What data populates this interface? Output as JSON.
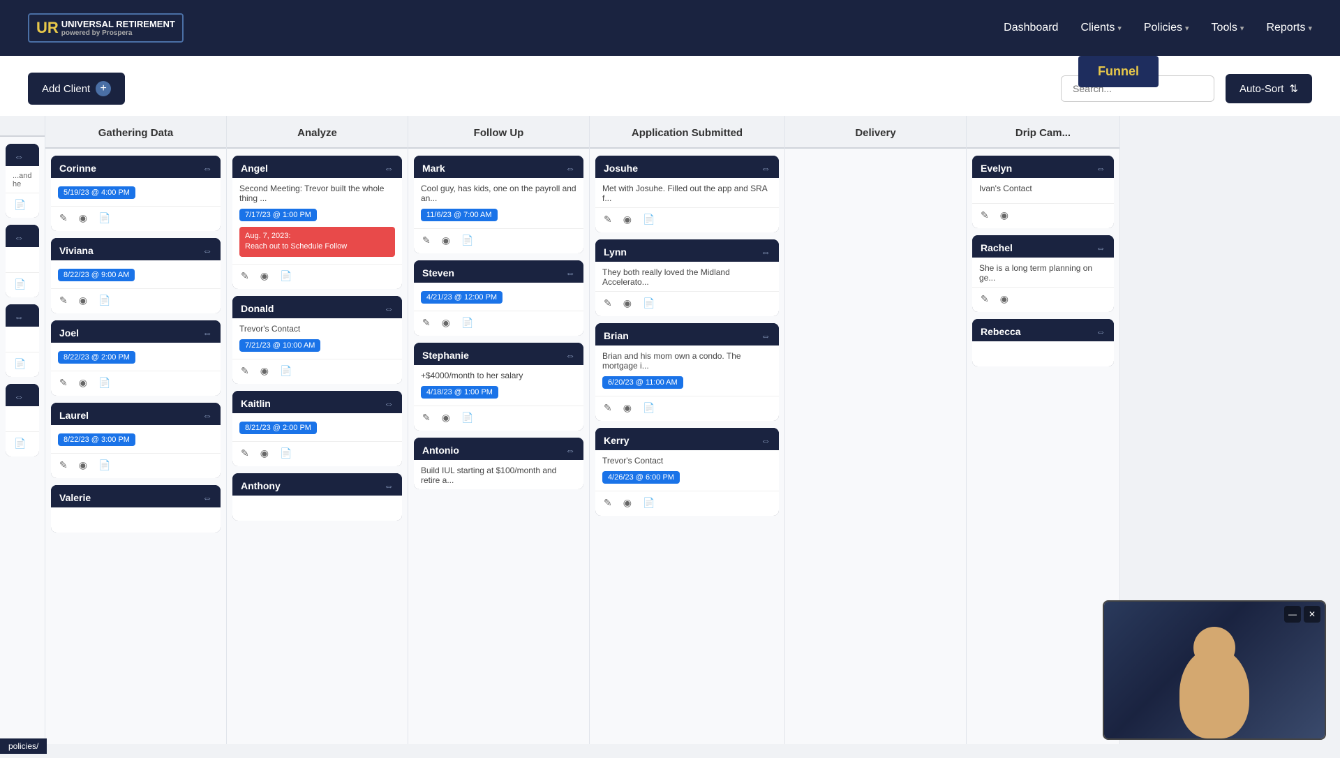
{
  "nav": {
    "logo_text": "UNIVERSAL RETIREMENT",
    "powered_text": "powered by Prospera",
    "links": [
      {
        "label": "Dashboard",
        "has_dropdown": false
      },
      {
        "label": "Clients",
        "has_dropdown": true
      },
      {
        "label": "Policies",
        "has_dropdown": true
      },
      {
        "label": "Tools",
        "has_dropdown": true
      },
      {
        "label": "Reports",
        "has_dropdown": true
      }
    ],
    "funnel_label": "Funnel"
  },
  "toolbar": {
    "add_client_label": "Add Client",
    "search_placeholder": "Search...",
    "autosort_label": "Auto-Sort"
  },
  "columns": [
    {
      "id": "partial-left",
      "header": "",
      "cards": [
        {
          "name": "",
          "move": true,
          "body": "...and he",
          "date": null,
          "date_text": null
        },
        {
          "name": "",
          "move": true,
          "body": "",
          "date": null,
          "date_text": null
        },
        {
          "name": "",
          "move": true,
          "body": "",
          "date": null,
          "date_text": null
        },
        {
          "name": "",
          "move": true,
          "body": "",
          "date": null,
          "date_text": null
        }
      ]
    },
    {
      "id": "gathering-data",
      "header": "Gathering Data",
      "cards": [
        {
          "name": "Corinne",
          "move": true,
          "body": "",
          "date": "5/19/23 @ 4:00 PM",
          "date_color": "blue"
        },
        {
          "name": "Viviana",
          "move": true,
          "body": "",
          "date": "8/22/23 @ 9:00 AM",
          "date_color": "blue"
        },
        {
          "name": "Joel",
          "move": true,
          "body": "",
          "date": "8/22/23 @ 2:00 PM",
          "date_color": "blue"
        },
        {
          "name": "Laurel",
          "move": true,
          "body": "",
          "date": "8/22/23 @ 3:00 PM",
          "date_color": "blue"
        },
        {
          "name": "Valerie",
          "move": true,
          "body": "",
          "date": null,
          "date_color": null
        }
      ]
    },
    {
      "id": "analyze",
      "header": "Analyze",
      "cards": [
        {
          "name": "Angel",
          "move": true,
          "body": "Second Meeting: Trevor built the whole thing ...",
          "date": "7/17/23 @ 1:00 PM",
          "date_color": "blue",
          "alert": "Aug. 7, 2023:\nReach out to Schedule Follow"
        },
        {
          "name": "Donald",
          "move": true,
          "body": "Trevor's Contact",
          "date": "7/21/23 @ 10:00 AM",
          "date_color": "blue"
        },
        {
          "name": "Kaitlin",
          "move": true,
          "body": "",
          "date": "8/21/23 @ 2:00 PM",
          "date_color": "blue"
        },
        {
          "name": "Anthony",
          "move": true,
          "body": "",
          "date": null,
          "date_color": null
        }
      ]
    },
    {
      "id": "follow-up",
      "header": "Follow Up",
      "cards": [
        {
          "name": "Mark",
          "move": true,
          "body": "Cool guy, has kids, one on the payroll and an...",
          "date": "11/6/23 @ 7:00 AM",
          "date_color": "blue"
        },
        {
          "name": "Steven",
          "move": true,
          "body": "",
          "date": "4/21/23 @ 12:00 PM",
          "date_color": "blue"
        },
        {
          "name": "Stephanie",
          "move": true,
          "body": "+$4000/month to her salary",
          "date": "4/18/23 @ 1:00 PM",
          "date_color": "blue"
        },
        {
          "name": "Antonio",
          "move": true,
          "body": "Build IUL starting at $100/month and retire a...",
          "date": null,
          "date_color": null
        }
      ]
    },
    {
      "id": "application-submitted",
      "header": "Application Submitted",
      "cards": [
        {
          "name": "Josuhe",
          "move": true,
          "body": "Met with Josuhe. Filled out the app and SRA f...",
          "date": null,
          "date_color": null
        },
        {
          "name": "Lynn",
          "move": true,
          "body": "They both really loved the Midland Accelerato...",
          "date": null,
          "date_color": null
        },
        {
          "name": "Brian",
          "move": true,
          "body": "Brian and his mom own a condo. The mortgage i...",
          "date": "6/20/23 @ 11:00 AM",
          "date_color": "blue"
        },
        {
          "name": "Kerry",
          "move": true,
          "body": "Trevor's Contact",
          "date": "4/26/23 @ 6:00 PM",
          "date_color": "blue"
        }
      ]
    },
    {
      "id": "delivery",
      "header": "Delivery",
      "cards": []
    },
    {
      "id": "drip-cam",
      "header": "Drip Cam...",
      "cards": [
        {
          "name": "Evelyn",
          "move": true,
          "body": "Ivan's Contact",
          "date": null,
          "date_color": null
        },
        {
          "name": "Rachel",
          "move": true,
          "body": "She is a long term planning on ge...",
          "date": null,
          "date_color": null
        },
        {
          "name": "Rebecca",
          "move": true,
          "body": "",
          "date": null,
          "date_color": null
        }
      ]
    }
  ],
  "status_bar": {
    "text": "policies/"
  },
  "icons": {
    "plus": "+",
    "chevron_down": "▾",
    "move": "⇔",
    "pencil": "✎",
    "eye": "◉",
    "doc": "📄",
    "sort": "⇅",
    "minimize": "—",
    "close": "✕"
  }
}
